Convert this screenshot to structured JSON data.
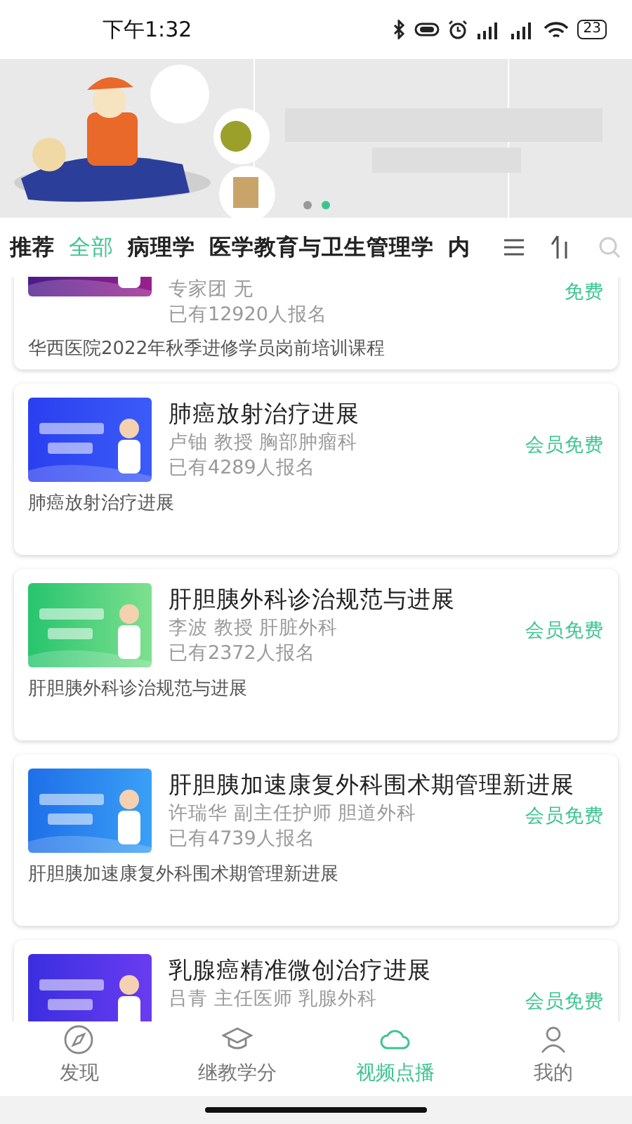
{
  "status_bar": {
    "time": "下午1:32",
    "battery": "23"
  },
  "banner": {
    "kind": "picture",
    "pages": [
      {
        "selected": false
      },
      {
        "selected": true
      }
    ]
  },
  "tabs": [
    {
      "label": "推荐",
      "selected": false
    },
    {
      "label": "全部",
      "selected": true
    },
    {
      "label": "病理学",
      "selected": false
    },
    {
      "label": "医学教育与卫生管理学",
      "selected": false
    },
    {
      "label": "内",
      "selected": false
    }
  ],
  "courses": [
    {
      "meta": "专家团 无",
      "enrolled": "已有12920人报名",
      "price": "免费",
      "description": "华西医院2022年秋季进修学员岗前培训课程"
    },
    {
      "title": "肺癌放射治疗进展",
      "meta": "卢铀 教授 胸部肿瘤科",
      "enrolled": "已有4289人报名",
      "price": "会员免费",
      "description": "肺癌放射治疗进展"
    },
    {
      "title": "肝胆胰外科诊治规范与进展",
      "meta": "李波 教授 肝脏外科",
      "enrolled": "已有2372人报名",
      "price": "会员免费",
      "description": "肝胆胰外科诊治规范与进展"
    },
    {
      "title": "肝胆胰加速康复外科围术期管理新进展",
      "meta": "许瑞华 副主任护师 胆道外科",
      "enrolled": "已有4739人报名",
      "price": "会员免费",
      "description": "肝胆胰加速康复外科围术期管理新进展"
    },
    {
      "title": "乳腺癌精准微创治疗进展",
      "meta": "吕青 主任医师 乳腺外科",
      "price": "会员免费"
    }
  ],
  "bottom_nav": [
    {
      "label": "发现",
      "selected": false
    },
    {
      "label": "继教学分",
      "selected": false
    },
    {
      "label": "视频点播",
      "selected": true
    },
    {
      "label": "我的",
      "selected": false
    }
  ]
}
